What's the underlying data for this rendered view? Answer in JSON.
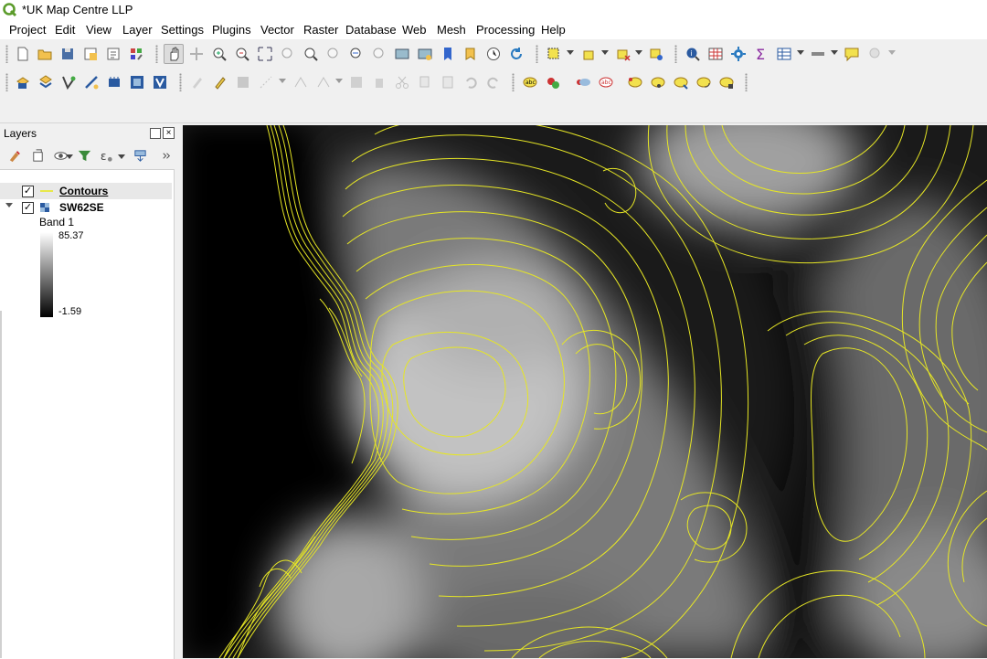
{
  "window": {
    "title": "*UK Map Centre LLP"
  },
  "menu": [
    "Project",
    "Edit",
    "View",
    "Layer",
    "Settings",
    "Plugins",
    "Vector",
    "Raster",
    "Database",
    "Web",
    "Mesh",
    "Processing",
    "Help"
  ],
  "layers_panel": {
    "title": "Layers",
    "layers": [
      {
        "name": "Contours",
        "checked": true,
        "symbol": "line",
        "color": "#e8e84a"
      },
      {
        "name": "SW62SE",
        "checked": true,
        "symbol": "raster",
        "expanded": true
      }
    ],
    "legend": {
      "band": "Band 1",
      "max": "85.37",
      "min": "-1.59"
    }
  },
  "map": {
    "contour_color": "#e6e625",
    "land_light": "#c8c8c8",
    "sea_color": "#000000"
  }
}
